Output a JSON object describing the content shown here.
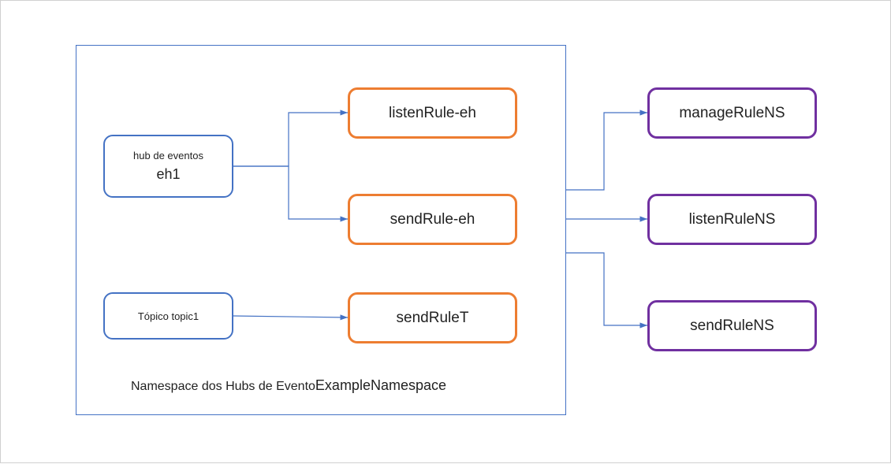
{
  "namespace": {
    "caption_prefix": "Namespace dos Hubs de Evento",
    "caption_name": "ExampleNamespace"
  },
  "left": {
    "eh": {
      "label_small": "hub de eventos",
      "name": "eh1"
    },
    "topic": {
      "label": "Tópico topic1"
    }
  },
  "rules": {
    "listen_eh": "listenRule-eh",
    "send_eh": "sendRule-eh",
    "send_t": "sendRuleT"
  },
  "ns_rules": {
    "manage": "manageRuleNS",
    "listen": "listenRuleNS",
    "send": "sendRuleNS"
  }
}
